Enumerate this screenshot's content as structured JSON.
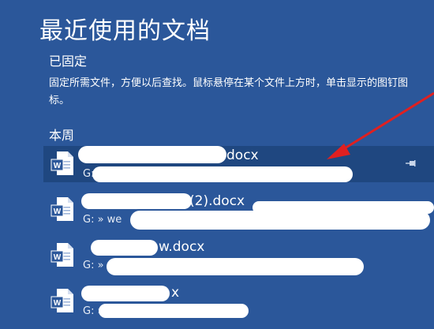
{
  "page": {
    "title": "最近使用的文档"
  },
  "pinned": {
    "heading": "已固定",
    "description": "固定所需文件，方便以后查找。鼠标悬停在某个文件上方时，单击显示的图钉图标。"
  },
  "this_week": {
    "heading": "本周",
    "files": [
      {
        "name": "docx",
        "path": "G:"
      },
      {
        "name": "(2).docx",
        "path": "G: » we"
      },
      {
        "name": "w.docx",
        "path": "G: »"
      },
      {
        "name": "x",
        "path": "G: »"
      }
    ]
  },
  "colors": {
    "background": "#2b579a",
    "selected_row": "#1f4780",
    "annotation_arrow": "#e02020"
  },
  "icons": {
    "file_icon": "word-doc-icon",
    "pin_icon": "pin-icon"
  }
}
